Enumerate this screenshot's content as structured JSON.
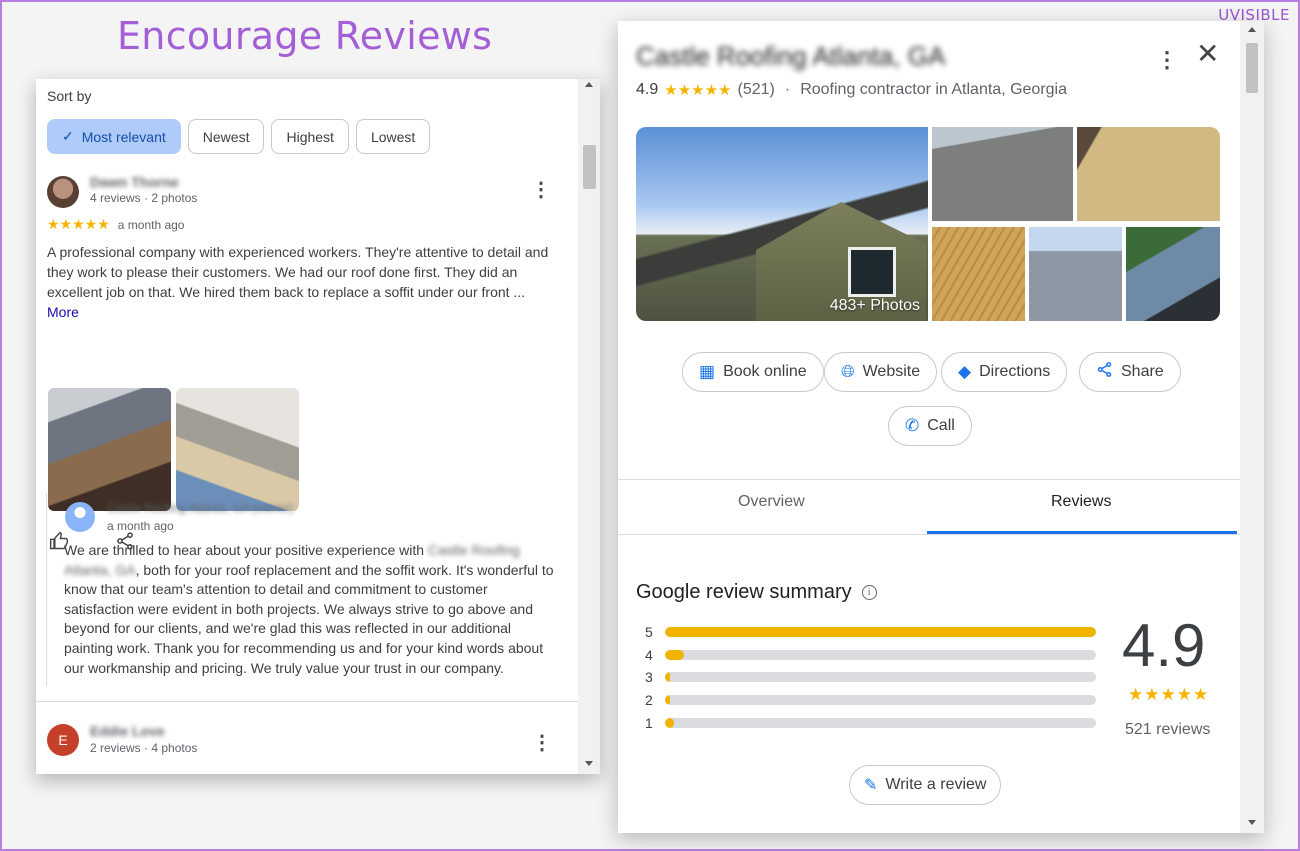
{
  "headline": "Encourage Reviews",
  "brand": "UVISIBLE",
  "left": {
    "sort_label": "Sort by",
    "chips": [
      {
        "label": "Most relevant",
        "active": true
      },
      {
        "label": "Newest"
      },
      {
        "label": "Highest"
      },
      {
        "label": "Lowest"
      }
    ],
    "review1": {
      "name": "Dawn Thorne",
      "meta": "4 reviews · 2 photos",
      "stars": "★★★★★",
      "time": "a month ago",
      "text": "A professional company with experienced workers. They're attentive to detail and they work to please their customers. We had our roof done first. They did an excellent job on that. We hired them back to replace a soffit under our front ...",
      "more": "More"
    },
    "owner_reply": {
      "name": "Castle Roofing Atlanta, GA (owner)",
      "time": "a month ago",
      "text_start": "We are thrilled to hear about your positive experience with ",
      "text_blur": "Castle Roofing Atlanta, GA",
      "text_rest": ", both for your roof replacement and the soffit work. It's wonderful to know that our team's attention to detail and commitment to customer satisfaction were evident in both projects. We always strive to go above and beyond for our clients, and we're glad this was reflected in our additional painting work. Thank you for recommending us and for your kind words about our workmanship and pricing. We truly value your trust in our company."
    },
    "review2": {
      "initial": "E",
      "name": "Eddie Love",
      "meta": "2 reviews · 4 photos"
    }
  },
  "right": {
    "title": "Castle Roofing Atlanta, GA",
    "rating": "4.9",
    "stars": "★★★★★",
    "count": "(521)",
    "separator": "·",
    "category": "Roofing contractor in Atlanta, Georgia",
    "photo_count": "483+ Photos",
    "actions": {
      "book": "Book online",
      "website": "Website",
      "directions": "Directions",
      "share": "Share",
      "call": "Call"
    },
    "tabs": {
      "overview": "Overview",
      "reviews": "Reviews"
    },
    "summary": {
      "title": "Google review summary",
      "distribution": [
        {
          "stars": "5",
          "fraction": 1.0
        },
        {
          "stars": "4",
          "fraction": 0.045
        },
        {
          "stars": "3",
          "fraction": 0.005
        },
        {
          "stars": "2",
          "fraction": 0.01
        },
        {
          "stars": "1",
          "fraction": 0.02
        }
      ],
      "average": "4.9",
      "stars": "★★★★★",
      "total": "521 reviews",
      "write_review": "Write a review"
    }
  },
  "colors": {
    "accent": "#1a73e8",
    "star": "#f4b400",
    "headline": "#a35fd6",
    "active_chip": "#aecbfa"
  }
}
